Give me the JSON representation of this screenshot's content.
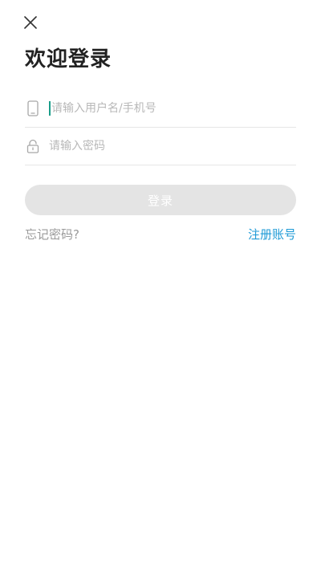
{
  "header": {
    "title": "欢迎登录"
  },
  "form": {
    "phone": {
      "placeholder": "请输入用户名/手机号",
      "value": ""
    },
    "password": {
      "placeholder": "请输入密码",
      "value": ""
    },
    "login_label": "登录"
  },
  "links": {
    "forgot": "忘记密码?",
    "register": "注册账号"
  },
  "colors": {
    "accent": "#1e9ad6",
    "caret": "#1a9e8a",
    "button_disabled": "#e4e4e4"
  },
  "icons": {
    "close": "close-icon",
    "phone": "phone-icon",
    "lock": "lock-icon"
  }
}
